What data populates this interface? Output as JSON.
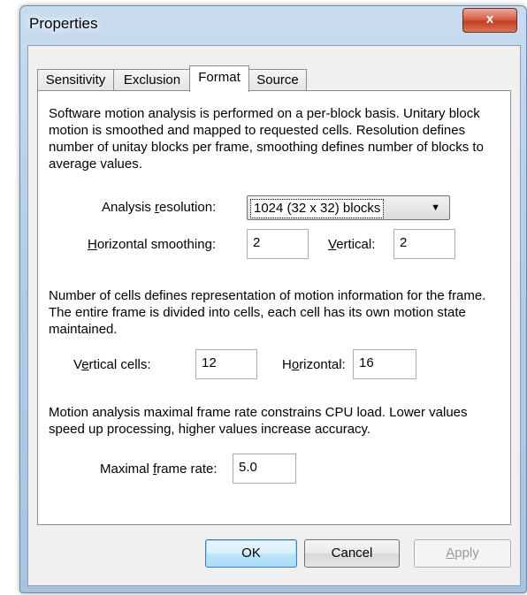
{
  "window": {
    "title": "Properties",
    "close_glyph": "x"
  },
  "tabs": [
    {
      "label": "Sensitivity"
    },
    {
      "label": "Exclusion"
    },
    {
      "label": "Format"
    },
    {
      "label": "Source"
    }
  ],
  "active_tab": "Format",
  "format": {
    "intro": "Software motion analysis is performed on a per-block basis. Unitary block motion is smoothed and mapped to requested cells. Resolution defines number of unitay blocks per frame, smoothing defines number of blocks to average values.",
    "analysis_resolution": {
      "label_pre": "Analysis ",
      "label_mn": "r",
      "label_post": "esolution:",
      "value": "1024 (32 x 32) blocks"
    },
    "horizontal_smoothing": {
      "label_pre": "",
      "label_mn": "H",
      "label_post": "orizontal smoothing:",
      "value": "2"
    },
    "vertical_smoothing": {
      "label_pre": "",
      "label_mn": "V",
      "label_post": "ertical:",
      "value": "2"
    },
    "cells_text": "Number of cells defines representation of motion information for the frame. The entire frame is divided into cells, each cell has its own motion state maintained.",
    "vertical_cells": {
      "label_pre": "V",
      "label_mn": "e",
      "label_post": "rtical cells:",
      "value": "12"
    },
    "horizontal_cells": {
      "label_pre": "H",
      "label_mn": "o",
      "label_post": "rizontal:",
      "value": "16"
    },
    "framerate_text": "Motion analysis maximal frame rate constrains CPU load. Lower values speed up processing, higher values increase accuracy.",
    "max_frame_rate": {
      "label_pre": "Maximal ",
      "label_mn": "f",
      "label_post": "rame rate:",
      "value": "5.0"
    }
  },
  "buttons": {
    "ok": "OK",
    "cancel": "Cancel",
    "apply_mn": "A",
    "apply_rest": "pply"
  },
  "icons": {
    "close": "close-icon",
    "dropdown": "chevron-down-icon"
  }
}
